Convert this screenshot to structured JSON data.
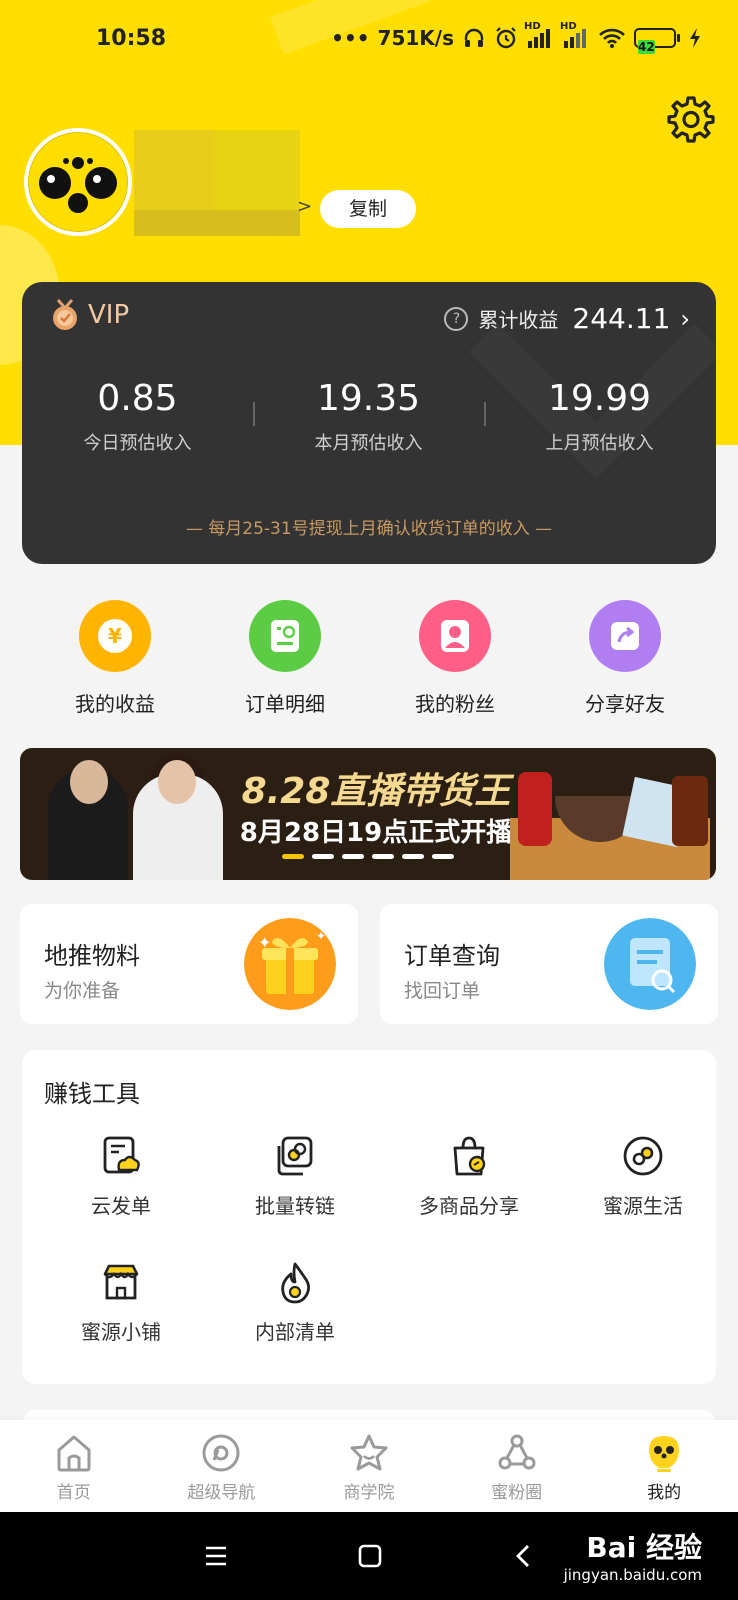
{
  "status_bar": {
    "time": "10:58",
    "network_speed": "751K/s",
    "signal1_label": "HD",
    "signal2_label": "HD",
    "battery": "42"
  },
  "profile": {
    "copy_label": "复制"
  },
  "vip": {
    "badge": "VIP",
    "total_label": "累计收益",
    "total_value": "244.11",
    "stats": [
      {
        "value": "0.85",
        "label": "今日预估收入"
      },
      {
        "value": "19.35",
        "label": "本月预估收入"
      },
      {
        "value": "19.99",
        "label": "上月预估收入"
      }
    ],
    "note": "— 每月25-31号提现上月确认收货订单的收入 —"
  },
  "quick_actions": [
    {
      "label": "我的收益",
      "color": "#ffb400"
    },
    {
      "label": "订单明细",
      "color": "#5ccc45"
    },
    {
      "label": "我的粉丝",
      "color": "#ff5f87"
    },
    {
      "label": "分享好友",
      "color": "#b07ef0"
    }
  ],
  "banner": {
    "title": "8.28直播带货王",
    "subtitle": "8月28日19点正式开播",
    "slides": 6,
    "active_slide": 1
  },
  "promos": [
    {
      "title": "地推物料",
      "subtitle": "为你准备"
    },
    {
      "title": "订单查询",
      "subtitle": "找回订单"
    }
  ],
  "tools": {
    "title": "赚钱工具",
    "items": [
      {
        "label": "云发单",
        "icon": "cloud-doc-icon"
      },
      {
        "label": "批量转链",
        "icon": "link-stack-icon"
      },
      {
        "label": "多商品分享",
        "icon": "bag-icon"
      },
      {
        "label": "蜜源生活",
        "icon": "chain-icon"
      },
      {
        "label": "蜜源小铺",
        "icon": "store-icon"
      },
      {
        "label": "内部清单",
        "icon": "flame-icon"
      }
    ]
  },
  "tabbar": [
    {
      "label": "首页",
      "icon": "home-icon"
    },
    {
      "label": "超级导航",
      "icon": "compass-icon"
    },
    {
      "label": "商学院",
      "icon": "star-icon"
    },
    {
      "label": "蜜粉圈",
      "icon": "circle-network-icon"
    },
    {
      "label": "我的",
      "icon": "bee-icon",
      "active": true
    }
  ],
  "watermark": {
    "brand": "Bai 经验",
    "url": "jingyan.baidu.com"
  },
  "colors": {
    "brand_yellow": "#ffde00",
    "card_dark": "#333333",
    "vip_gold": "#f2c9a3",
    "note_gold": "#c79a63"
  }
}
